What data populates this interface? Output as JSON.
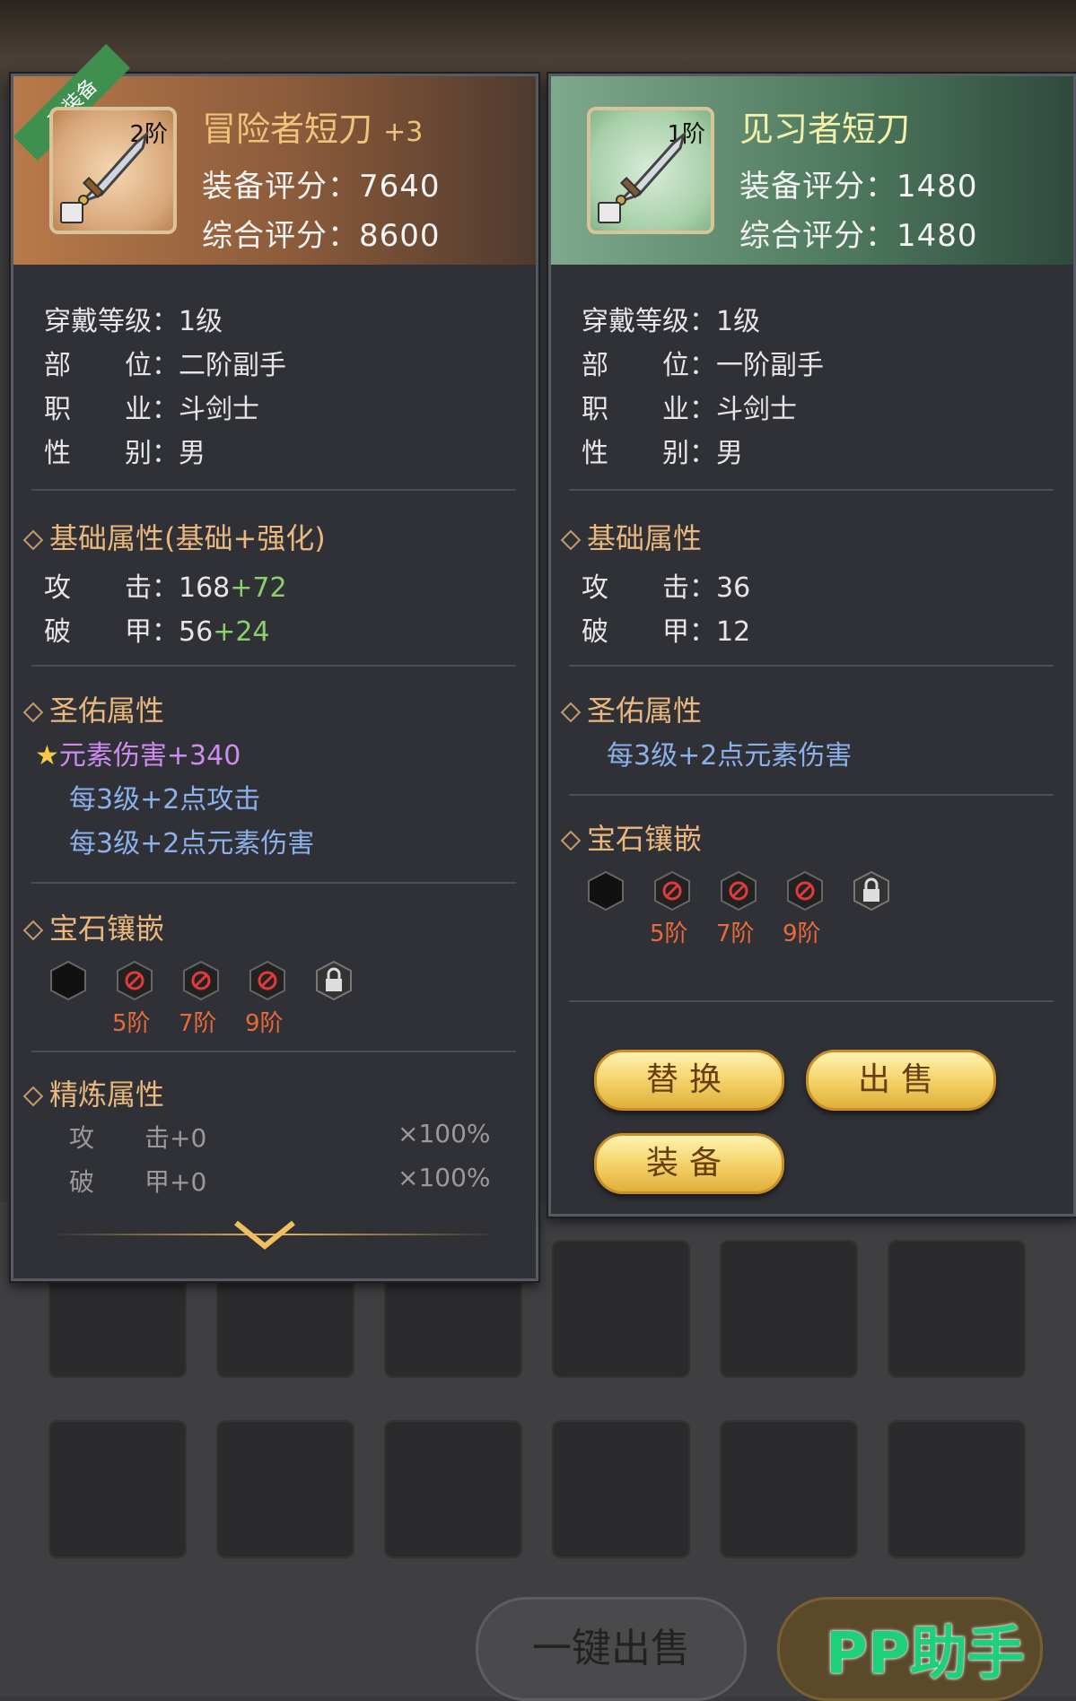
{
  "left_panel": {
    "equipped_badge": "已装备",
    "tier": "2阶",
    "title": "冒险者短刀",
    "enhance": "+3",
    "equip_score": "装备评分：7640",
    "total_score": "综合评分：8600",
    "info": [
      {
        "label": "穿戴等级：",
        "value": "1级"
      },
      {
        "label": "部　　位：",
        "value": "二阶副手"
      },
      {
        "label": "职　　业：",
        "value": "斗剑士"
      },
      {
        "label": "性　　别：",
        "value": "男"
      }
    ],
    "base_title": "基础属性(基础+强化)",
    "base": [
      {
        "label": "攻　　击：",
        "value": "168",
        "bonus": "+72"
      },
      {
        "label": "破　　甲：",
        "value": "56",
        "bonus": "+24"
      }
    ],
    "holy_title": "圣佑属性",
    "holy": [
      "元素伤害+340",
      "每3级+2点攻击",
      "每3级+2点元素伤害"
    ],
    "gem_title": "宝石镶嵌",
    "gem_labels": [
      "5阶",
      "7阶",
      "9阶"
    ],
    "refine_title": "精炼属性",
    "refine": [
      {
        "label": "攻　　击+0",
        "value": "×100%"
      },
      {
        "label": "破　　甲+0",
        "value": "×100%"
      }
    ]
  },
  "right_panel": {
    "tier": "1阶",
    "title": "见习者短刀",
    "equip_score": "装备评分：1480",
    "total_score": "综合评分：1480",
    "info": [
      {
        "label": "穿戴等级：",
        "value": "1级"
      },
      {
        "label": "部　　位：",
        "value": "一阶副手"
      },
      {
        "label": "职　　业：",
        "value": "斗剑士"
      },
      {
        "label": "性　　别：",
        "value": "男"
      }
    ],
    "base_title": "基础属性",
    "base": [
      {
        "label": "攻　　击：",
        "value": "36"
      },
      {
        "label": "破　　甲：",
        "value": "12"
      }
    ],
    "holy_title": "圣佑属性",
    "holy": [
      "每3级+2点元素伤害"
    ],
    "gem_title": "宝石镶嵌",
    "gem_labels": [
      "5阶",
      "7阶",
      "9阶"
    ],
    "buttons": {
      "replace": "替换",
      "sell": "出售",
      "equip": "装备"
    }
  },
  "bottom": {
    "one_click_sell": "一键出售",
    "watermark": "PP助手"
  },
  "colors": {
    "green_bonus": "#8bd06b",
    "purple_holy": "#cf8cf0",
    "blue_holy": "#8bb0ea",
    "gem_red": "#e96a3a"
  }
}
